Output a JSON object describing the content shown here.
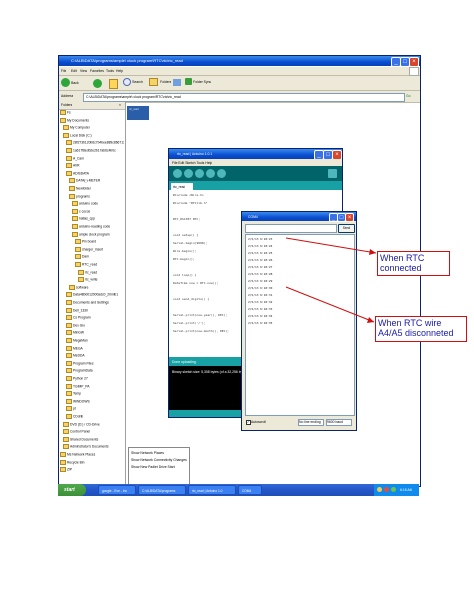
{
  "explorer": {
    "title": "C:\\ALB\\DATA\\programs\\ample\\ clock program\\RTC\\rtc\\rtc_read",
    "menu": [
      "File",
      "Edit",
      "View",
      "Favorites",
      "Tools",
      "Help"
    ],
    "toolbar": {
      "back": "Back",
      "search": "Search",
      "folders": "Folders",
      "folder_sync": "Folder Sync"
    },
    "address_label": "Address",
    "address_value": "C:\\ALB\\DATA\\programs\\ample\\ clock program\\RTC\\rtc\\rtc_read",
    "go_label": "Go",
    "folders_header": "Folders",
    "tree": [
      "Fs",
      "My Documents",
      "My Computer",
      "Local Disk (C:)",
      "28f273b120b6c7b4bee889c8667134",
      "1a617f8edb2e2b17ab6c4b0c",
      "A_Cam",
      "AVR",
      "ADISDATA",
      "DATA(-)-METER",
      "Newfolder",
      "programs",
      "arduino code",
      "c cocos",
      "hatlas_cpp",
      "arduino-reading code",
      "ample clock program",
      "Pin board",
      "charger_insert",
      "Dam",
      "RTC_read",
      "rtc_read",
      "rtc_write",
      "software",
      "Data48b0012000adc0_20mlb1",
      "Documents and Settings",
      "Dell_1330",
      "Cs Program",
      "Dex Gio",
      "MinGW",
      "MegaMan",
      "MEGA",
      "MeDDA",
      "Program Files",
      "ProgramData",
      "Python 27",
      "TGIMP_PA",
      "Temp",
      "WINDOWS",
      "pt",
      "CDdrib",
      "DVD (D:) / CD-Drive",
      "Control Panel",
      "Shared Documents",
      "Adminstrator's Documents",
      "Ms Network Places",
      "Recycle Bin",
      "ZIP"
    ]
  },
  "context_menu": [
    "Show Network Places",
    "Show Network Connectivity Changes",
    "Show New Padlet Drive Start"
  ],
  "ide": {
    "title": "rtc_read | Arduino 1.0.1",
    "menu": "File Edit Sketch Tools Help",
    "tab": "rtc_read",
    "code": [
      "#include <Wire.h>",
      "#include \"RTClib.h\"",
      "",
      "RTC_DS1307 RTC;",
      "",
      "void setup() {",
      "  Serial.begin(9600);",
      "  Wire.begin();",
      "  RTC.begin();",
      "",
      "void loop() {",
      "  DateTime now = RTC.now();",
      "",
      "void send_digits() {",
      "",
      "  Serial.print(now.year(), DEC);",
      "  Serial.print('/');",
      "  Serial.print(now.month(), DEC);"
    ],
    "status": "Done uploading.",
    "console": "Binary sketch size: 5,308 bytes (of a 32,256 byte maximum)",
    "footer": "Arduino Uno on COM4"
  },
  "serial": {
    "title": "COM4",
    "send_label": "Send",
    "lines": [
      "2/5/13 6:18:23",
      "2/5/13 6:18:24",
      "2/5/13 6:18:25",
      "2/5/13 6:18:26",
      "2/5/13 6:18:27",
      "2/5/13 6:18:28",
      "2/5/13 6:18:29",
      "2/5/13 6:18:30",
      "2/5/13 6:18:31",
      "2/5/13 6:18:32",
      "2/5/13 6:18:33",
      "2/5/13 6:18:34",
      "2/5/13 6:18:35"
    ],
    "autoscroll_label": "Autoscroll",
    "line_ending": "No line ending",
    "baud": "9600 baud"
  },
  "annotations": {
    "connected": "When RTC connected",
    "disconnected": "When RTC wire A4/A5 disconneted",
    "color": "#d01010",
    "text_color": "#1a1aa8"
  },
  "taskbar": {
    "start": "start",
    "tasks": [
      "google - Eve - Inc",
      "C:\\ALB\\DATA\\programs",
      "rtc_read | Arduino 1.0",
      "COM4"
    ],
    "clock": "6:18 AM"
  }
}
